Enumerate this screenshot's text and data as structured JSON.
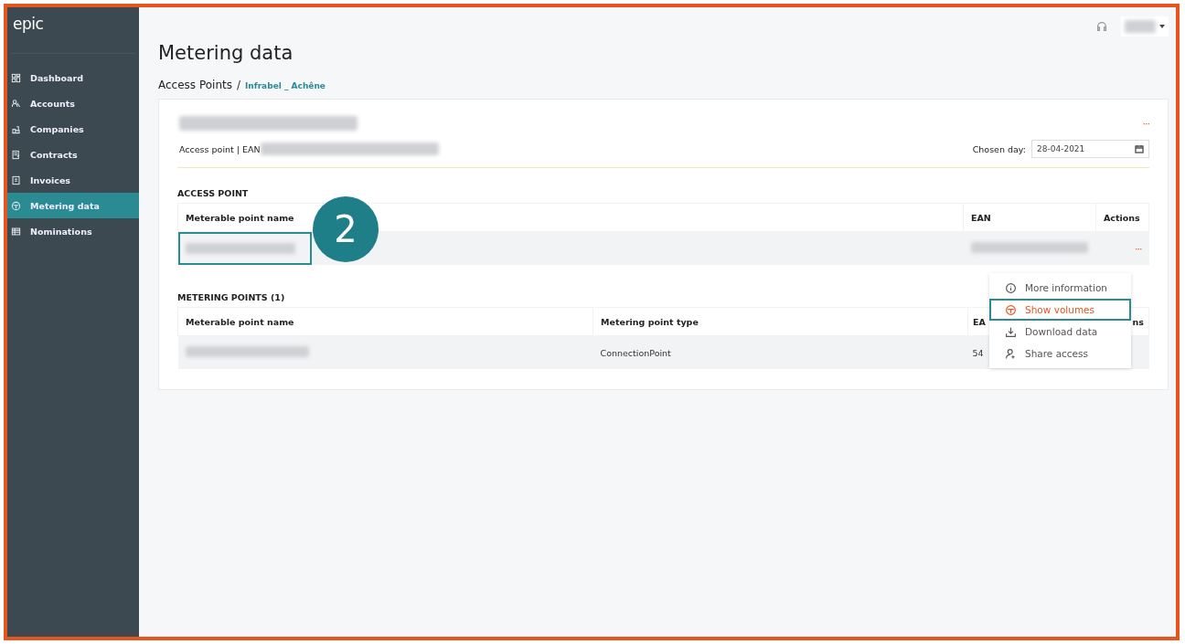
{
  "sidebar": {
    "logo": "epic",
    "items": [
      {
        "label": "Dashboard",
        "selected": false
      },
      {
        "label": "Accounts",
        "selected": false
      },
      {
        "label": "Companies",
        "selected": false
      },
      {
        "label": "Contracts",
        "selected": false
      },
      {
        "label": "Invoices",
        "selected": false
      },
      {
        "label": "Metering data",
        "selected": true
      },
      {
        "label": "Nominations",
        "selected": false
      }
    ]
  },
  "header": {
    "title": "Metering data",
    "breadcrumb": [
      {
        "label": "Access Points",
        "kind": "plain"
      },
      {
        "label": "/",
        "kind": "separator"
      },
      {
        "label": "Infrabel _ Achêne",
        "kind": "link"
      }
    ]
  },
  "card": {
    "title": {
      "redacted": true
    },
    "subtitle_label": "Access point | EAN",
    "subtitle_value": {
      "redacted": true
    },
    "more": "···",
    "chosen_day_label": "Chosen day:",
    "chosen_day": "28-04-2021"
  },
  "access_point": {
    "title": "ACCESS POINT",
    "columns": [
      "Meterable point name",
      "EAN",
      "Actions"
    ],
    "rows": [
      {
        "name": {
          "redacted": true,
          "highlighted": true
        },
        "ean": {
          "redacted": true
        },
        "actions": "···"
      }
    ]
  },
  "metering_points": {
    "title": "METERING POINTS (1)",
    "columns": [
      "Meterable point name",
      "Metering point type",
      "EA",
      "ns"
    ],
    "rows": [
      {
        "name": {
          "redacted": true
        },
        "type": "ConnectionPoint",
        "ean": "54"
      }
    ]
  },
  "menu": [
    {
      "label": "More information",
      "selected": false
    },
    {
      "label": "Show volumes",
      "selected": true
    },
    {
      "label": "Download data",
      "selected": false
    },
    {
      "label": "Share access",
      "selected": false
    }
  ],
  "callout": "2"
}
